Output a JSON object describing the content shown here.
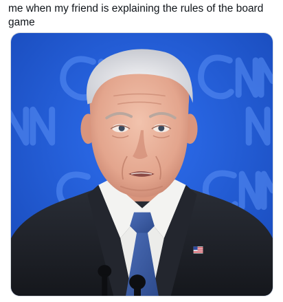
{
  "post": {
    "caption": "me when my friend is explaining the rules of the board game"
  },
  "image": {
    "background_watermark": "CNN",
    "background_color": "#1f5ad6",
    "suit_color": "#1e2128",
    "tie_color": "#3d5fa8",
    "shirt_color": "#f3f3f1"
  }
}
